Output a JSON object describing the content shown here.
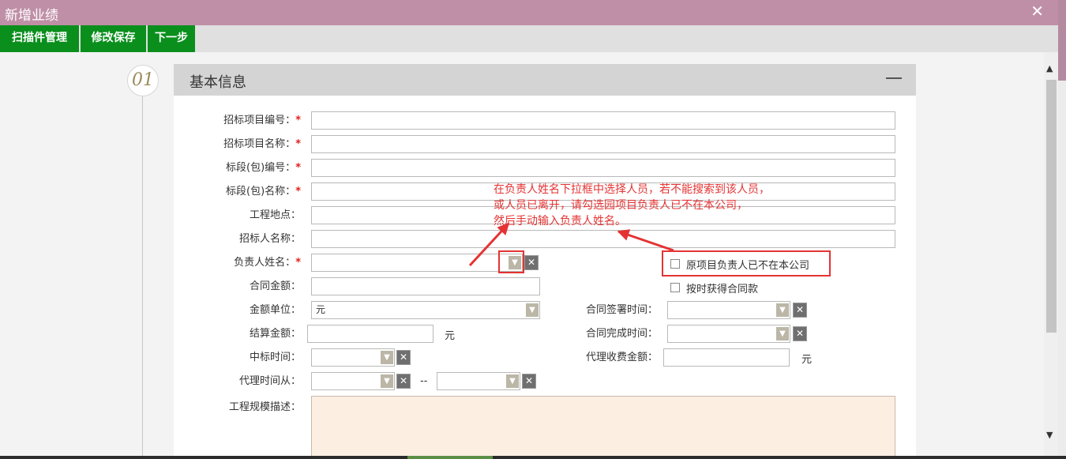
{
  "window": {
    "title": "新增业绩",
    "close_glyph": "✕"
  },
  "toolbar": {
    "scan_label": "扫描件管理",
    "save_label": "修改保存",
    "next_label": "下一步"
  },
  "section": {
    "number": "01",
    "title": "基本信息"
  },
  "form": {
    "tender_no": {
      "label": "招标项目编号：",
      "required": "*"
    },
    "tender_name": {
      "label": "招标项目名称：",
      "required": "*"
    },
    "lot_no": {
      "label": "标段(包)编号：",
      "required": "*"
    },
    "lot_name": {
      "label": "标段(包)名称：",
      "required": "*"
    },
    "location": {
      "label": "工程地点："
    },
    "tenderer": {
      "label": "招标人名称："
    },
    "manager": {
      "label": "负责人姓名：",
      "required": "*"
    },
    "manager_left_label": "原项目负责人已不在本公司",
    "on_time_label": "按时获得合同款",
    "contract_amount": {
      "label": "合同金额："
    },
    "amount_unit": {
      "label": "金额单位：",
      "value": "元"
    },
    "sign_time": {
      "label": "合同签署时间："
    },
    "settle_amount": {
      "label": "结算金额：",
      "unit": "元"
    },
    "complete_time": {
      "label": "合同完成时间："
    },
    "win_time": {
      "label": "中标时间："
    },
    "agency_fee": {
      "label": "代理收费金额：",
      "unit": "元"
    },
    "agency_from": {
      "label": "代理时间从：",
      "separator": "--"
    },
    "scale_desc": {
      "label": "工程规模描述："
    }
  },
  "annotation": {
    "lines": [
      "在负责人姓名下拉框中选择人员，若不能搜索到该人员，",
      "或人员已离开，请勾选园项目负责人已不在本公司，",
      "然后手动输入负责人姓名。"
    ],
    "color": "#e53333"
  },
  "colors": {
    "titlebar": "#bf8fa7",
    "toolbar_button": "#0a8f1d",
    "textarea_bg": "#fdeee2"
  },
  "icons": {
    "dropdown": "▼",
    "clear": "✕",
    "scroll_up": "▲",
    "scroll_down": "▼"
  }
}
